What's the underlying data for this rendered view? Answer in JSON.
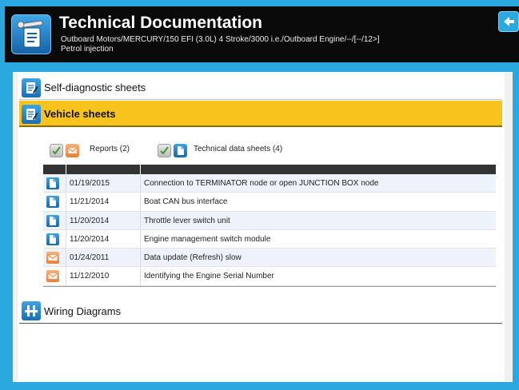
{
  "header": {
    "title": "Technical Documentation",
    "subtitle_line1": "Outboard Motors/MERCURY/150 EFI (3.0L) 4 Stroke/3000 i.e./Outboard Engine/--/[--/12>]",
    "subtitle_line2": "Petrol injection"
  },
  "sections": {
    "self_diagnostic": "Self-diagnostic sheets",
    "vehicle": "Vehicle sheets",
    "wiring": "Wiring Diagrams"
  },
  "filters": {
    "reports": "Reports (2)",
    "technical": "Technical data sheets (4)"
  },
  "rows": [
    {
      "type": "doc",
      "date": "01/19/2015",
      "desc": "Connection to TERMINATOR node or open JUNCTION BOX node"
    },
    {
      "type": "doc",
      "date": "11/21/2014",
      "desc": "Boat CAN bus interface"
    },
    {
      "type": "doc",
      "date": "11/20/2014",
      "desc": "Throttle lever switch unit"
    },
    {
      "type": "doc",
      "date": "11/20/2014",
      "desc": "Engine management switch module"
    },
    {
      "type": "mail",
      "date": "01/24/2011",
      "desc": "Data update (Refresh) slow"
    },
    {
      "type": "mail",
      "date": "11/12/2010",
      "desc": "Identifying the Engine Serial Number"
    }
  ],
  "colors": {
    "frame": "#29a9e0",
    "header_bg": "#0a0a0a",
    "active_section": "#f8c31c"
  }
}
